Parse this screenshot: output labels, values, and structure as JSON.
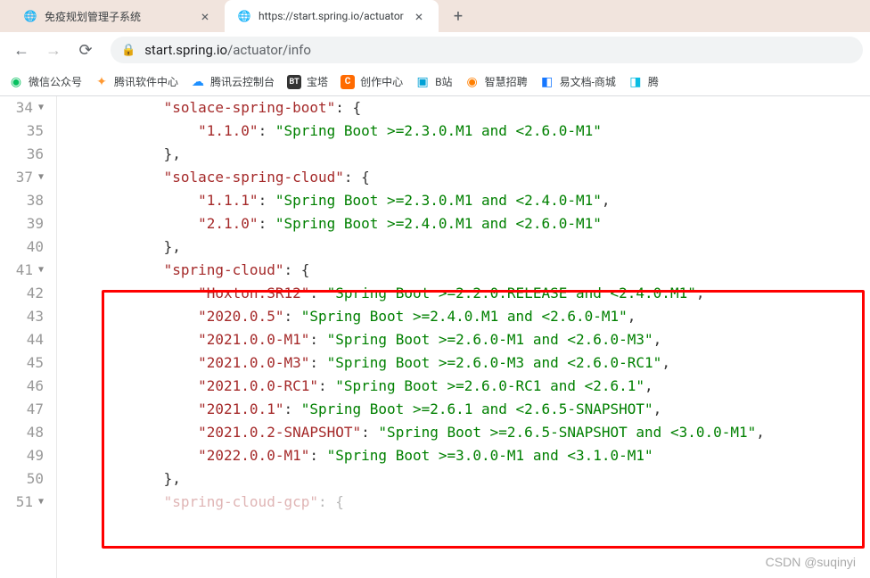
{
  "tabs": [
    {
      "title": "免疫规划管理子系统",
      "active": false
    },
    {
      "title": "https://start.spring.io/actuator",
      "active": true
    }
  ],
  "url": {
    "domain": "start.spring.io",
    "path": "/actuator/info"
  },
  "bookmarks": [
    {
      "label": "微信公众号"
    },
    {
      "label": "腾讯软件中心"
    },
    {
      "label": "腾讯云控制台"
    },
    {
      "label": "宝塔"
    },
    {
      "label": "创作中心"
    },
    {
      "label": "B站"
    },
    {
      "label": "智慧招聘"
    },
    {
      "label": "易文档-商城"
    },
    {
      "label": "腾"
    }
  ],
  "code": {
    "lines": [
      {
        "num": "34",
        "fold": true,
        "indent": 3,
        "parts": [
          {
            "t": "key",
            "v": "\"solace-spring-boot\""
          },
          {
            "t": "punct",
            "v": ": {"
          }
        ]
      },
      {
        "num": "35",
        "fold": false,
        "indent": 4,
        "parts": [
          {
            "t": "key",
            "v": "\"1.1.0\""
          },
          {
            "t": "punct",
            "v": ": "
          },
          {
            "t": "str",
            "v": "\"Spring Boot >=2.3.0.M1 and <2.6.0-M1\""
          }
        ]
      },
      {
        "num": "36",
        "fold": false,
        "indent": 3,
        "parts": [
          {
            "t": "punct",
            "v": "},"
          }
        ]
      },
      {
        "num": "37",
        "fold": true,
        "indent": 3,
        "parts": [
          {
            "t": "key",
            "v": "\"solace-spring-cloud\""
          },
          {
            "t": "punct",
            "v": ": {"
          }
        ]
      },
      {
        "num": "38",
        "fold": false,
        "indent": 4,
        "parts": [
          {
            "t": "key",
            "v": "\"1.1.1\""
          },
          {
            "t": "punct",
            "v": ": "
          },
          {
            "t": "str",
            "v": "\"Spring Boot >=2.3.0.M1 and <2.4.0-M1\""
          },
          {
            "t": "punct",
            "v": ","
          }
        ]
      },
      {
        "num": "39",
        "fold": false,
        "indent": 4,
        "parts": [
          {
            "t": "key",
            "v": "\"2.1.0\""
          },
          {
            "t": "punct",
            "v": ": "
          },
          {
            "t": "str",
            "v": "\"Spring Boot >=2.4.0.M1 and <2.6.0-M1\""
          }
        ]
      },
      {
        "num": "40",
        "fold": false,
        "indent": 3,
        "parts": [
          {
            "t": "punct",
            "v": "},"
          }
        ]
      },
      {
        "num": "41",
        "fold": true,
        "indent": 3,
        "parts": [
          {
            "t": "key",
            "v": "\"spring-cloud\""
          },
          {
            "t": "punct",
            "v": ": {"
          }
        ]
      },
      {
        "num": "42",
        "fold": false,
        "indent": 4,
        "parts": [
          {
            "t": "key",
            "v": "\"Hoxton.SR12\""
          },
          {
            "t": "punct",
            "v": ": "
          },
          {
            "t": "str",
            "v": "\"Spring Boot >=2.2.0.RELEASE and <2.4.0.M1\""
          },
          {
            "t": "punct",
            "v": ","
          }
        ]
      },
      {
        "num": "43",
        "fold": false,
        "indent": 4,
        "parts": [
          {
            "t": "key",
            "v": "\"2020.0.5\""
          },
          {
            "t": "punct",
            "v": ": "
          },
          {
            "t": "str",
            "v": "\"Spring Boot >=2.4.0.M1 and <2.6.0-M1\""
          },
          {
            "t": "punct",
            "v": ","
          }
        ]
      },
      {
        "num": "44",
        "fold": false,
        "indent": 4,
        "parts": [
          {
            "t": "key",
            "v": "\"2021.0.0-M1\""
          },
          {
            "t": "punct",
            "v": ": "
          },
          {
            "t": "str",
            "v": "\"Spring Boot >=2.6.0-M1 and <2.6.0-M3\""
          },
          {
            "t": "punct",
            "v": ","
          }
        ]
      },
      {
        "num": "45",
        "fold": false,
        "indent": 4,
        "parts": [
          {
            "t": "key",
            "v": "\"2021.0.0-M3\""
          },
          {
            "t": "punct",
            "v": ": "
          },
          {
            "t": "str",
            "v": "\"Spring Boot >=2.6.0-M3 and <2.6.0-RC1\""
          },
          {
            "t": "punct",
            "v": ","
          }
        ]
      },
      {
        "num": "46",
        "fold": false,
        "indent": 4,
        "parts": [
          {
            "t": "key",
            "v": "\"2021.0.0-RC1\""
          },
          {
            "t": "punct",
            "v": ": "
          },
          {
            "t": "str",
            "v": "\"Spring Boot >=2.6.0-RC1 and <2.6.1\""
          },
          {
            "t": "punct",
            "v": ","
          }
        ]
      },
      {
        "num": "47",
        "fold": false,
        "indent": 4,
        "parts": [
          {
            "t": "key",
            "v": "\"2021.0.1\""
          },
          {
            "t": "punct",
            "v": ": "
          },
          {
            "t": "str",
            "v": "\"Spring Boot >=2.6.1 and <2.6.5-SNAPSHOT\""
          },
          {
            "t": "punct",
            "v": ","
          }
        ]
      },
      {
        "num": "48",
        "fold": false,
        "indent": 4,
        "parts": [
          {
            "t": "key",
            "v": "\"2021.0.2-SNAPSHOT\""
          },
          {
            "t": "punct",
            "v": ": "
          },
          {
            "t": "str",
            "v": "\"Spring Boot >=2.6.5-SNAPSHOT and <3.0.0-M1\""
          },
          {
            "t": "punct",
            "v": ","
          }
        ]
      },
      {
        "num": "49",
        "fold": false,
        "indent": 4,
        "parts": [
          {
            "t": "key",
            "v": "\"2022.0.0-M1\""
          },
          {
            "t": "punct",
            "v": ": "
          },
          {
            "t": "str",
            "v": "\"Spring Boot >=3.0.0-M1 and <3.1.0-M1\""
          }
        ]
      },
      {
        "num": "50",
        "fold": false,
        "indent": 3,
        "parts": [
          {
            "t": "punct",
            "v": "},"
          }
        ]
      },
      {
        "num": "51",
        "fold": true,
        "indent": 3,
        "parts": [
          {
            "t": "key",
            "v": "\"spring-cloud-gcp\""
          },
          {
            "t": "punct",
            "v": ": {"
          }
        ],
        "cut": true
      }
    ]
  },
  "watermark": "CSDN @suqinyi"
}
